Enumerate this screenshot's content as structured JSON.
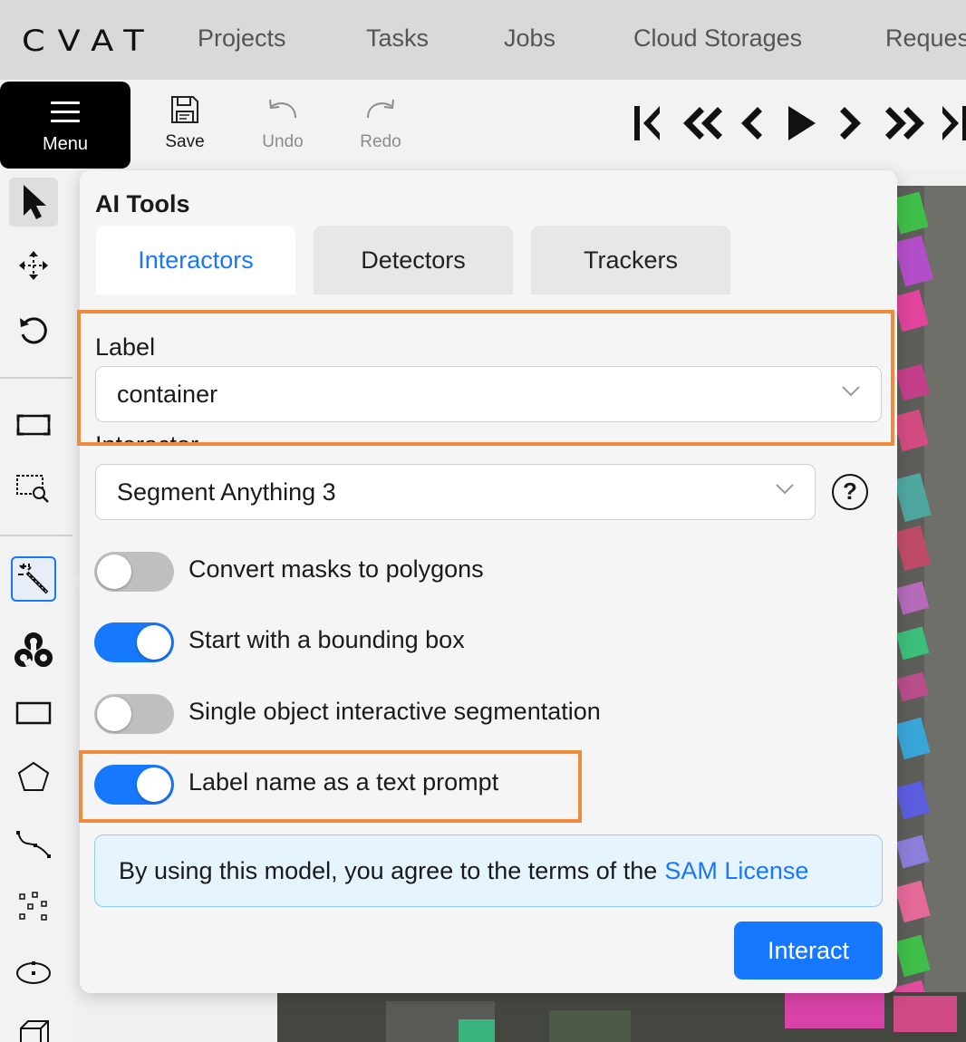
{
  "app": {
    "logo_text": "CVAT",
    "nav": [
      "Projects",
      "Tasks",
      "Jobs",
      "Cloud Storages",
      "Reques"
    ]
  },
  "toolbar": {
    "menu_label": "Menu",
    "save_label": "Save",
    "undo_label": "Undo",
    "redo_label": "Redo"
  },
  "ai_tools": {
    "title": "AI Tools",
    "tabs": [
      "Interactors",
      "Detectors",
      "Trackers"
    ],
    "active_tab": "Interactors",
    "label_field": {
      "label": "Label",
      "value": "container"
    },
    "interactor_field": {
      "label": "Interactor",
      "value": "Segment Anything 3"
    },
    "help_glyph": "?",
    "toggles": [
      {
        "label": "Convert masks to polygons",
        "on": false
      },
      {
        "label": "Start with a bounding box",
        "on": true
      },
      {
        "label": "Single object interactive segmentation",
        "on": false
      },
      {
        "label": "Label name as a text prompt",
        "on": true
      }
    ],
    "notice": {
      "text": "By using this model, you agree to the terms of the",
      "link": "SAM License"
    },
    "interact_button": "Interact"
  },
  "colors": {
    "accent": "#1677ff",
    "highlight": "#f08a3c"
  }
}
